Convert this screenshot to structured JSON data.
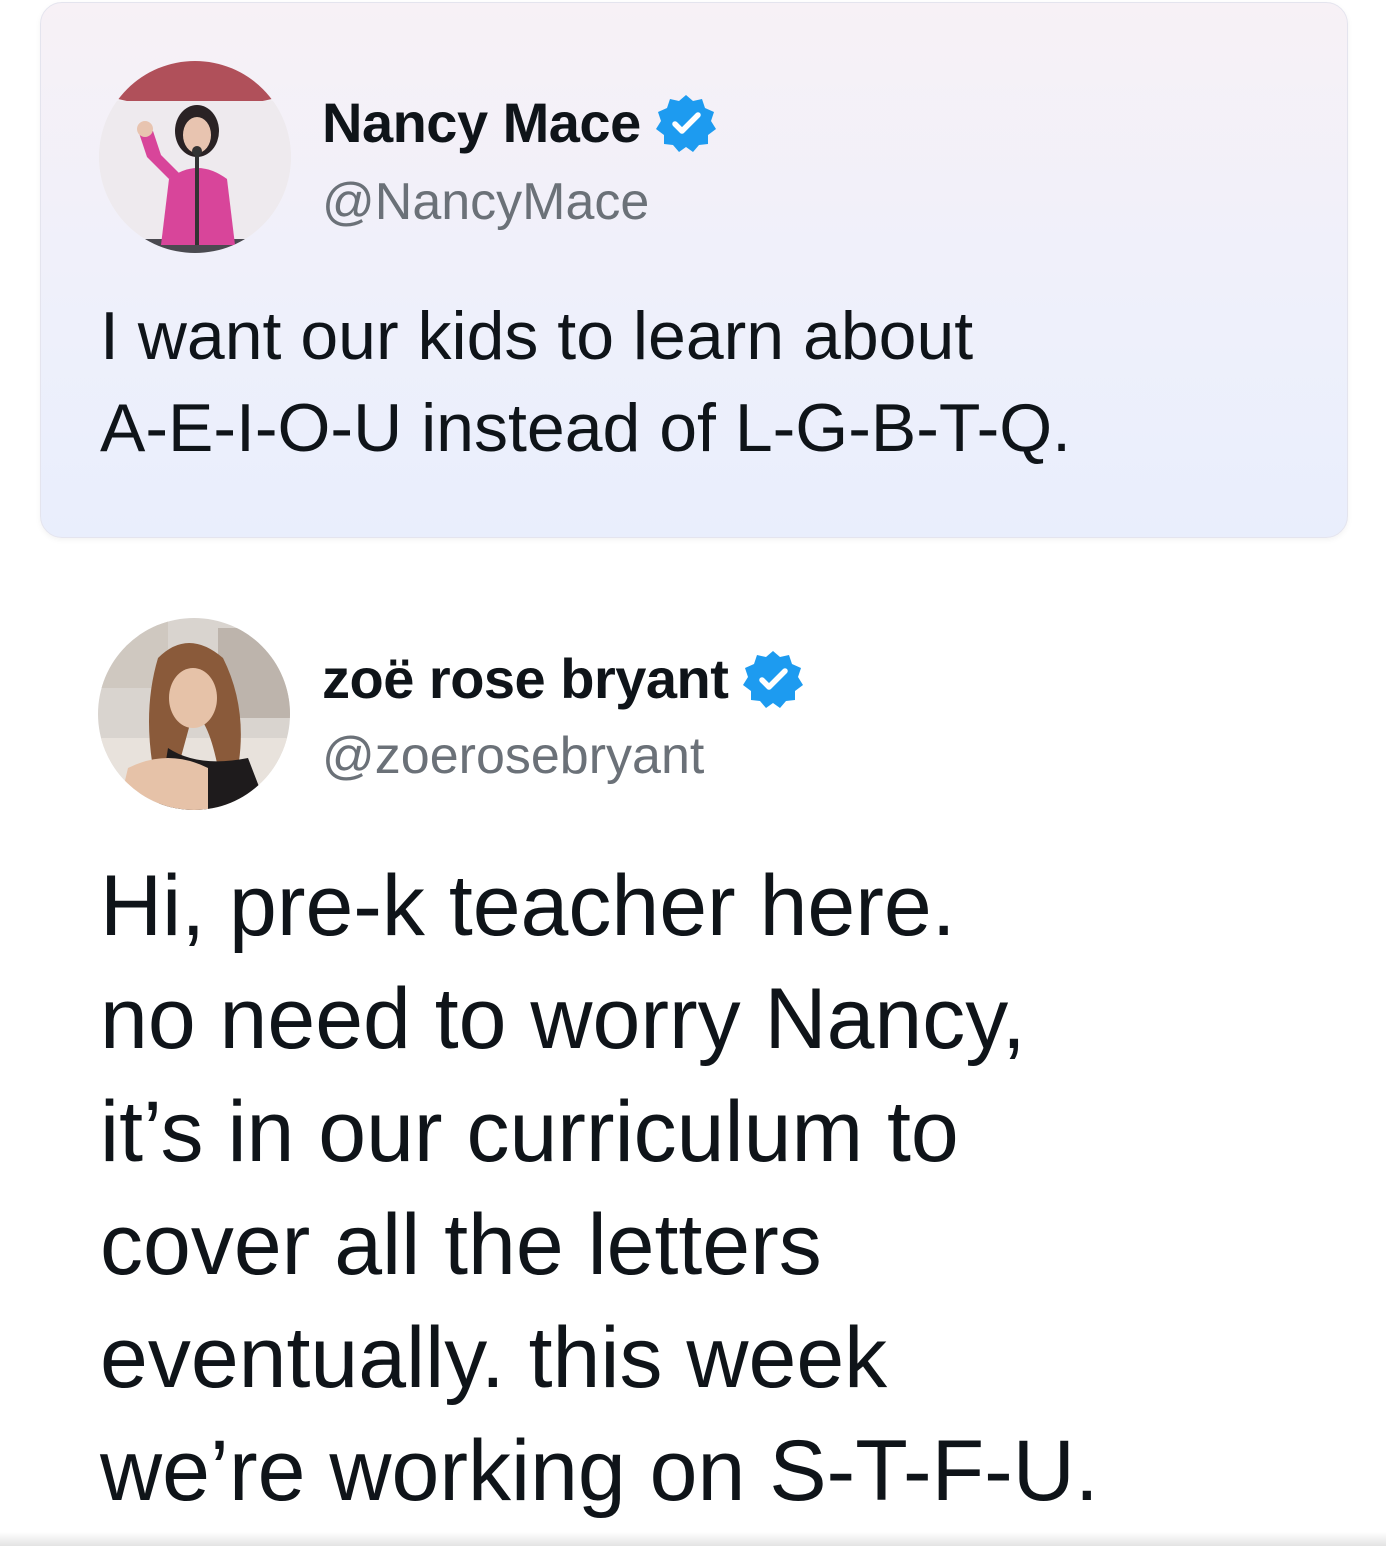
{
  "quoted_tweet": {
    "author": {
      "display_name": "Nancy Mace",
      "handle": "@NancyMace",
      "verified": true,
      "avatar": "profile-photo-woman-pink-top-at-podium"
    },
    "text_lines": [
      "I want our kids to learn about",
      "A-E-I-O-U instead of L-G-B-T-Q."
    ]
  },
  "reply_tweet": {
    "author": {
      "display_name": "zoë rose bryant",
      "handle": "@zoerosebryant",
      "verified": true,
      "avatar": "profile-photo-woman-long-hair"
    },
    "text_lines": [
      "Hi, pre-k teacher here.",
      "no need to worry Nancy,",
      "it’s in our curriculum to",
      "cover all the letters",
      "eventually. this week",
      "we’re working on S-T-F-U."
    ]
  },
  "colors": {
    "verified_badge": "#1d9bf0",
    "handle_text": "#6b7178",
    "card_background": "#eef0fb"
  }
}
